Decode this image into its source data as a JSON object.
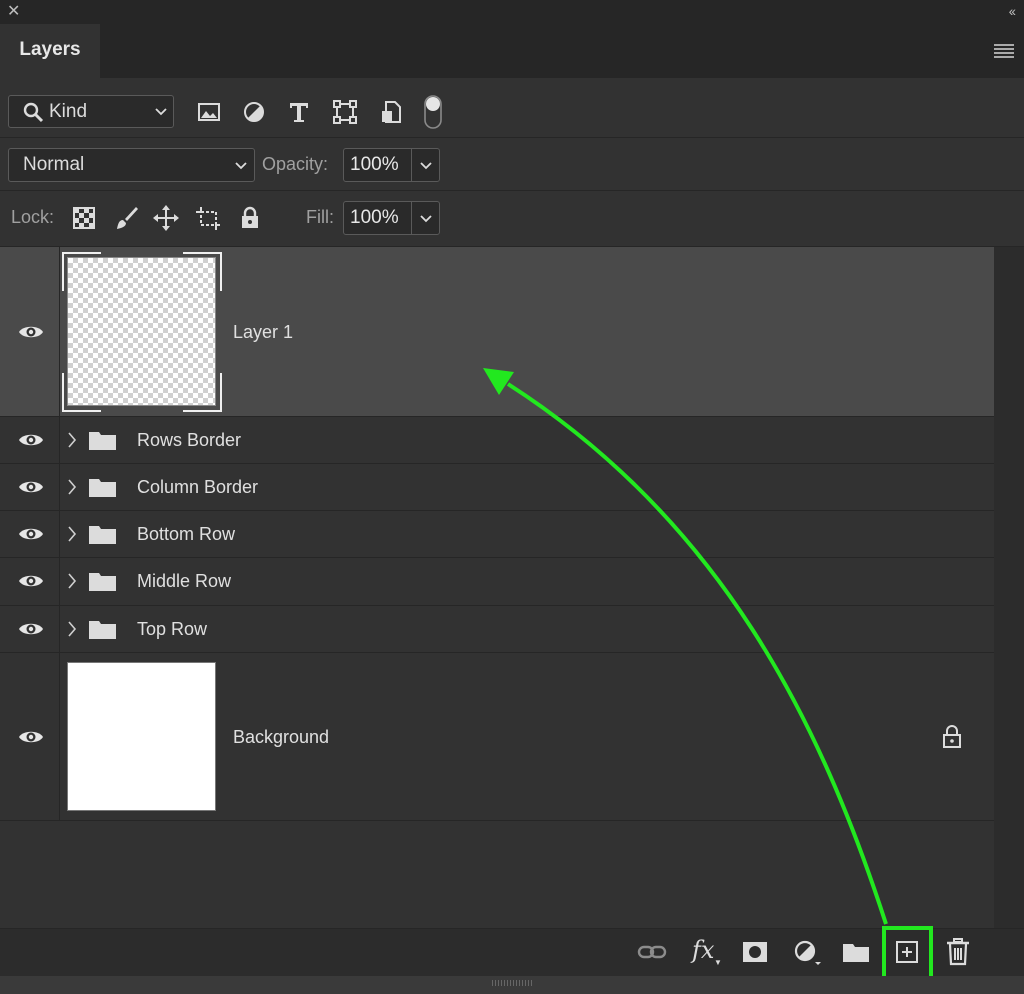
{
  "panel": {
    "tab_label": "Layers"
  },
  "filter": {
    "kind_label": "Kind",
    "icons": [
      "image-filter-icon",
      "adjustment-filter-icon",
      "type-filter-icon",
      "shape-filter-icon",
      "smart-object-filter-icon",
      "filter-toggle-icon"
    ]
  },
  "blend": {
    "mode": "Normal",
    "opacity_label": "Opacity:",
    "opacity_value": "100%"
  },
  "lock": {
    "label": "Lock:",
    "fill_label": "Fill:",
    "fill_value": "100%"
  },
  "layers": [
    {
      "name": "Layer 1",
      "type": "pixel",
      "selected": true
    },
    {
      "name": "Rows Border",
      "type": "group"
    },
    {
      "name": "Column Border",
      "type": "group"
    },
    {
      "name": "Bottom Row",
      "type": "group"
    },
    {
      "name": "Middle Row",
      "type": "group"
    },
    {
      "name": "Top Row",
      "type": "group"
    },
    {
      "name": "Background",
      "type": "background",
      "locked": true
    }
  ],
  "footer": {
    "fx_label": "fx",
    "icons": [
      "link-icon",
      "fx-icon",
      "mask-icon",
      "adjustment-icon",
      "new-group-icon",
      "new-layer-icon",
      "trash-icon"
    ]
  },
  "colors": {
    "highlight": "#22e81f",
    "panel": "#323232",
    "selected_row": "#4a4a4a"
  }
}
